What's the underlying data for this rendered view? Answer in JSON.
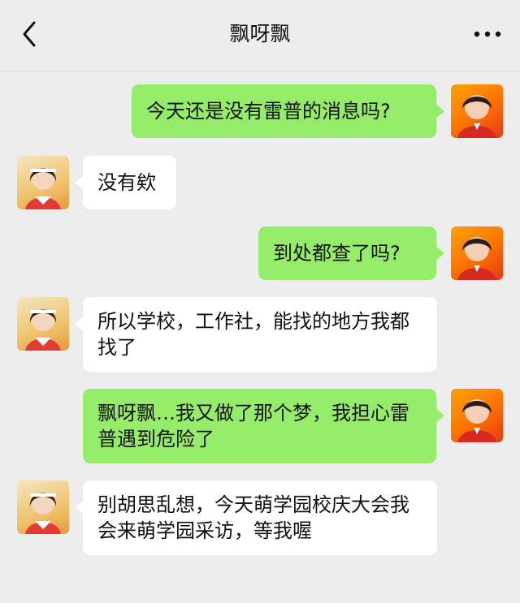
{
  "header": {
    "title": "飘呀飘",
    "back_icon": "chevron-left-icon",
    "more_icon": "ellipsis-icon"
  },
  "colors": {
    "background": "#ededed",
    "self_bubble": "#95ec69",
    "other_bubble": "#ffffff",
    "text": "#111111"
  },
  "messages": [
    {
      "sender": "self",
      "text": "今天还是没有雷普的消息吗?"
    },
    {
      "sender": "other",
      "text": "没有欸"
    },
    {
      "sender": "self",
      "text": "到处都查了吗?"
    },
    {
      "sender": "other",
      "text": "所以学校，工作社，能找的地方我都找了"
    },
    {
      "sender": "self",
      "text": "飘呀飘…我又做了那个梦，我担心雷普遇到危险了"
    },
    {
      "sender": "other",
      "text": "别胡思乱想，今天萌学园校庆大会我会来萌学园采访，等我喔"
    }
  ]
}
